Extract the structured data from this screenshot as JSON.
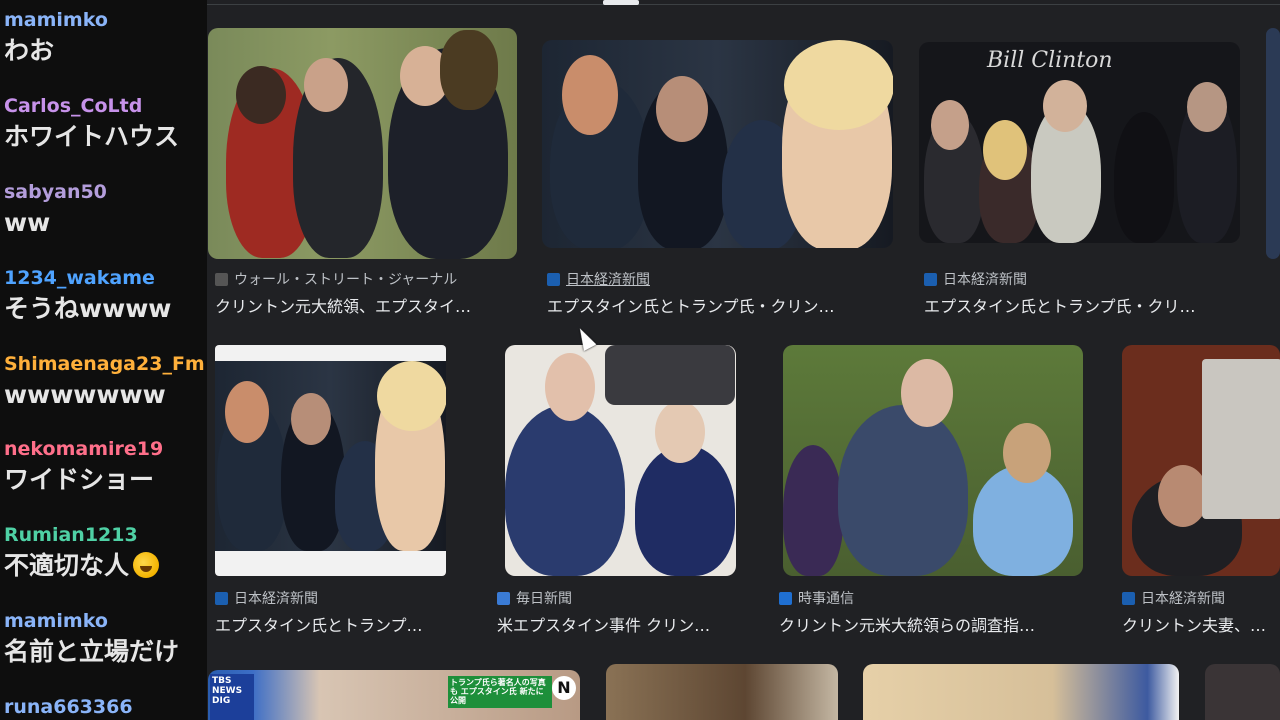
{
  "chat": [
    {
      "user": "mamimko",
      "color": "#8ab4f8",
      "text": "わお"
    },
    {
      "user": "Carlos_CoLtd",
      "color": "#c792ea",
      "text": "ホワイトハウス"
    },
    {
      "user": "sabyan50",
      "color": "#b39ddb",
      "text": "ww"
    },
    {
      "user": "1234_wakame",
      "color": "#4fa3ff",
      "text": "そうねwwww"
    },
    {
      "user": "Shimaenaga23_Fm",
      "color": "#ffb03b",
      "text": "wwwwwww"
    },
    {
      "user": "nekomamire19",
      "color": "#ff6f8a",
      "text": "ワイドショー"
    },
    {
      "user": "Rumian1213",
      "color": "#4fd1a5",
      "text": "不適切な人"
    },
    {
      "user": "mamimko",
      "color": "#8ab4f8",
      "text": "名前と立場だけ"
    },
    {
      "user": "runa663366",
      "color": "#8ab4f8",
      "text": ""
    }
  ],
  "results": {
    "row1": [
      {
        "source": "ウォール・ストリート・ジャーナル",
        "title": "クリントン元大統領、エプスタイ…",
        "favicon": "wsj-icon"
      },
      {
        "source": "日本経済新聞",
        "title": "エプスタイン氏とトランプ氏・クリン…",
        "favicon": "nikkei-icon"
      },
      {
        "source": "日本経済新聞",
        "title": "エプスタイン氏とトランプ氏・クリ…",
        "favicon": "nikkei-icon"
      }
    ],
    "row2": [
      {
        "source": "日本経済新聞",
        "title": "エプスタイン氏とトランプ…",
        "favicon": "nikkei-icon"
      },
      {
        "source": "毎日新聞",
        "title": "米エプスタイン事件 クリン…",
        "favicon": "mainichi-icon"
      },
      {
        "source": "時事通信",
        "title": "クリントン元米大統領らの調査指…",
        "favicon": "jiji-icon"
      },
      {
        "source": "日本経済新聞",
        "title": "クリントン夫妻、…",
        "favicon": "nikkei-icon"
      }
    ],
    "row3_badges": {
      "tbs": "TBS NEWS DIG",
      "banner": "トランプ氏ら著名人の写真も エプスタイン氏 新たに公開"
    },
    "photo_caption": "Bill Clinton"
  },
  "colors": {
    "background": "#202124",
    "chat_bg": "#0e0e0e",
    "text": "#e8eaed",
    "meta": "#bdc1c6"
  }
}
